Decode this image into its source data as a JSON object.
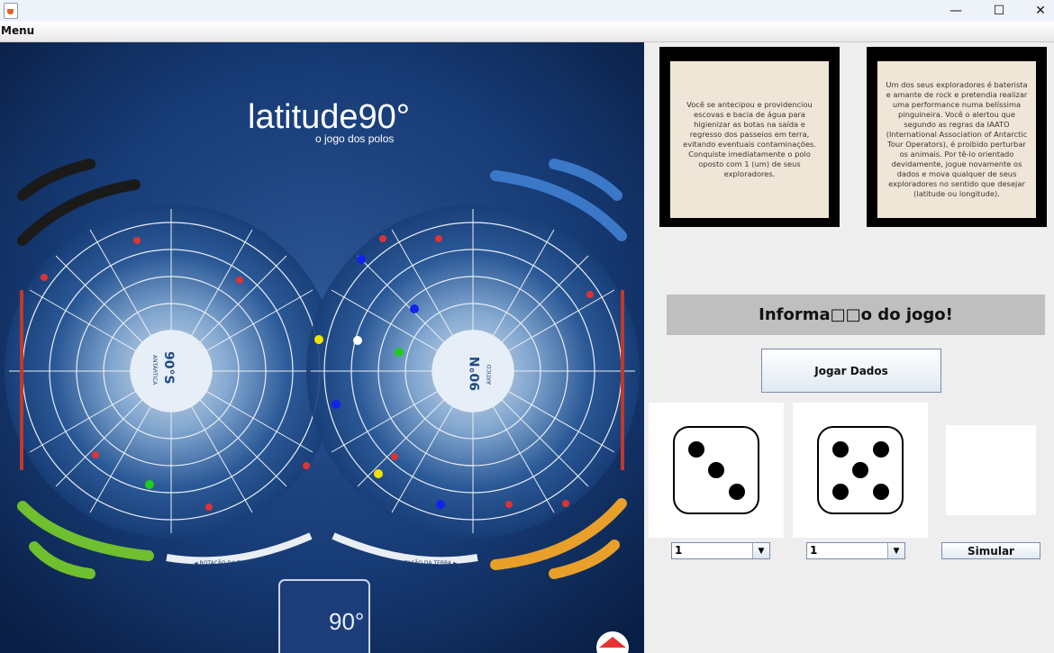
{
  "window": {
    "minimize_glyph": "—",
    "maximize_glyph": "☐",
    "close_glyph": "✕"
  },
  "menu": {
    "label": "Menu"
  },
  "board": {
    "title": "latitude90°",
    "subtitle": "o jogo dos polos",
    "south_label": "90°S",
    "south_sub": "ANTÁRTICA",
    "north_label": "90°N",
    "north_sub": "ÁRTICO",
    "rotation_left": "◄ ROTAÇÃO DA TERRA",
    "rotation_right": "ROTAÇÃO DA TERRA ►",
    "deck_label": "90°",
    "colors": {
      "ocean": "#0f2a55",
      "tracks_black": "#1a1a1a",
      "tracks_blue": "#3c78c8",
      "tracks_green": "#6fbf2e",
      "tracks_orange": "#e8a02a"
    }
  },
  "cards": [
    {
      "text": "Você se antecipou e providenciou escovas e bacia de água para higienizar as botas na saída e regresso dos passeios em terra, evitando eventuais contaminações. Conquiste imediatamente o polo oposto com 1 (um) de seus exploradores."
    },
    {
      "text": "Um dos seus exploradores é baterista e amante de rock e pretendia realizar uma performance numa belíssima pinguineira. Você o alertou que segundo as regras da IAATO (International Association of Antarctic Tour Operators), é proibido perturbar os animais. Por tê-lo orientado devidamente, jogue novamente os dados e mova qualquer de seus exploradores no sentido que desejar (latitude ou longitude)."
    }
  ],
  "info": {
    "title": "Informa□□o do jogo!"
  },
  "buttons": {
    "roll": "Jogar Dados",
    "simulate": "Simular"
  },
  "dice": [
    {
      "value": 3,
      "select_value": "1"
    },
    {
      "value": 5,
      "select_value": "1"
    }
  ]
}
